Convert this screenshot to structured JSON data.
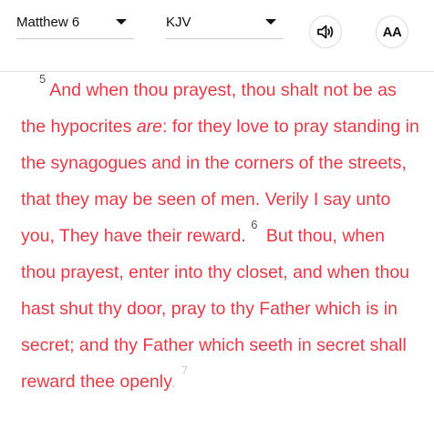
{
  "header": {
    "book_chapter": "Matthew 6",
    "version": "KJV",
    "font_button_label": "AA",
    "icons": {
      "audio": "speaker-icon",
      "dropdown": "chevron-down-icon"
    }
  },
  "passage": {
    "verse5": {
      "number": "5",
      "text_a": "And when thou prayest, thou shalt not be as the hypocrites ",
      "text_em": "are",
      "text_b": ": for they love to pray standing in the synagogues and in the corners of the streets, that they may be seen of men. Verily I say unto you, They have their reward. "
    },
    "verse6": {
      "number": "6",
      "text_main": "But thou, when thou prayest, enter into thy closet, and when thou hast shut thy door, pray to thy Father which is in secret; and thy Father which seeth in secret shall reward thee openly",
      "text_tail": "."
    },
    "verse7": {
      "number": "7"
    }
  },
  "colors": {
    "text_accent": "#e63946",
    "verse_number": "#555555"
  }
}
